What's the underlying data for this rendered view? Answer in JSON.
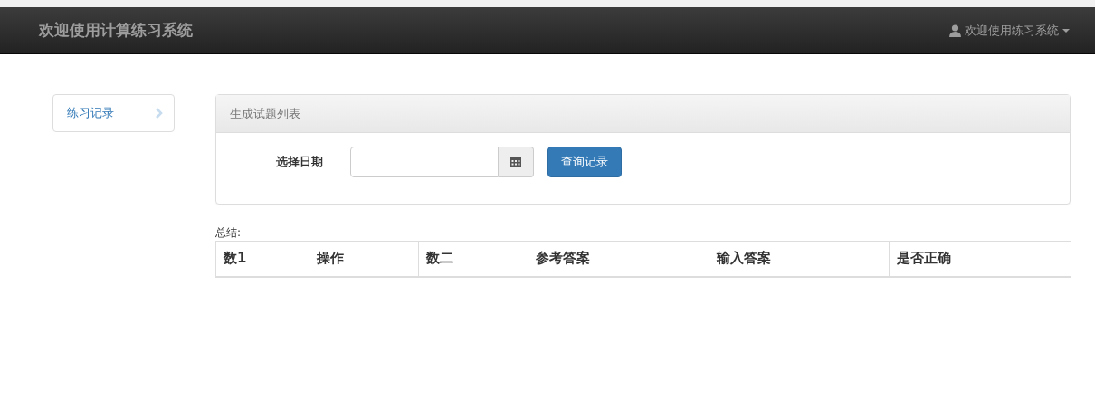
{
  "navbar": {
    "brand": "欢迎使用计算练习系统",
    "user_menu": "欢迎使用练习系统"
  },
  "sidebar": {
    "items": [
      {
        "label": "练习记录"
      }
    ]
  },
  "panel": {
    "title": "生成试题列表",
    "date_label": "选择日期",
    "query_button": "查询记录"
  },
  "summary_label": "总结:",
  "table": {
    "columns": [
      "数1",
      "操作",
      "数二",
      "参考答案",
      "输入答案",
      "是否正确"
    ]
  }
}
